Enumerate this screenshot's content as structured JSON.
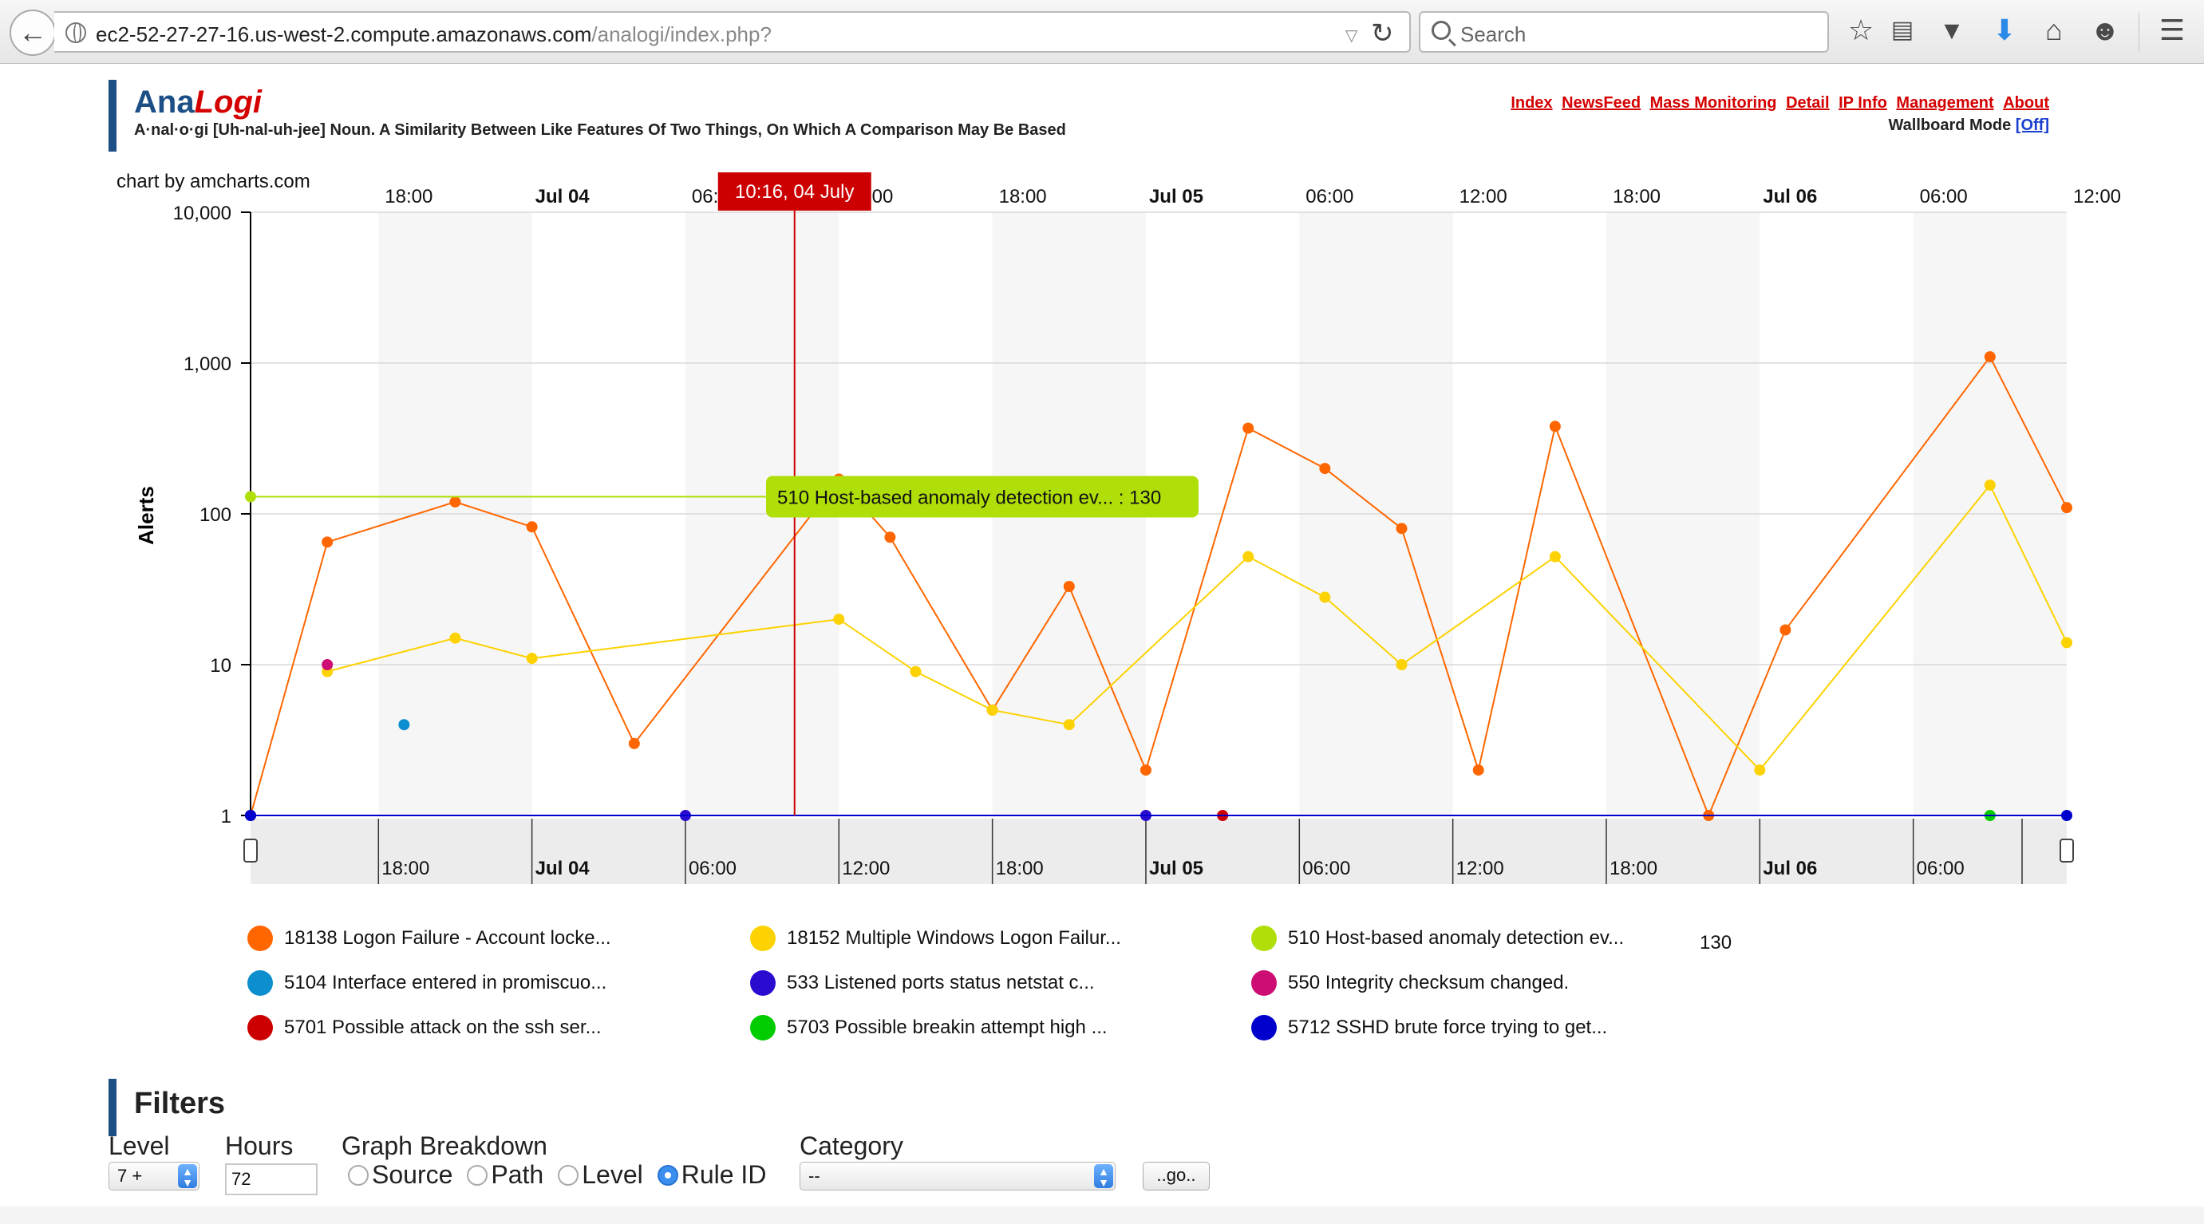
{
  "browser": {
    "url_host": "ec2-52-27-27-16.us-west-2.compute.amazonaws.com",
    "url_path": "/analogi/index.php?",
    "search_placeholder": "Search",
    "icons": [
      "back-arrow-icon",
      "globe-icon",
      "dropdown-arrow-icon",
      "reload-icon",
      "search-icon",
      "bookmark-star-icon",
      "reading-list-icon",
      "pocket-icon",
      "download-icon",
      "home-icon",
      "smiley-icon",
      "hamburger-menu-icon"
    ]
  },
  "header": {
    "brand_ana": "Ana",
    "brand_logi": "Logi",
    "tagline": "A·nal·o·gi [Uh-nal-uh-jee] Noun. A Similarity Between Like Features Of Two Things, On Which A Comparison May Be Based",
    "nav": [
      "Index",
      "NewsFeed",
      "Mass Monitoring",
      "Detail",
      "IP Info",
      "Management",
      "About"
    ],
    "wallboard_label": "Wallboard Mode",
    "wallboard_state": "[Off]"
  },
  "chart_credit": "chart by amcharts.com",
  "chart_data": {
    "type": "line",
    "ylabel": "Alerts",
    "y_scale": "log",
    "ylim": [
      1,
      10000
    ],
    "y_ticks": [
      "1",
      "10",
      "100",
      "1,000",
      "10,000"
    ],
    "x_ticks_top": [
      "18:00",
      "Jul 04",
      "06:00",
      "12:00",
      "18:00",
      "Jul 05",
      "06:00",
      "12:00",
      "18:00",
      "Jul 06",
      "06:00",
      "12:00"
    ],
    "x_ticks_bottom": [
      "18:00",
      "Jul 04",
      "06:00",
      "12:00",
      "18:00",
      "Jul 05",
      "06:00",
      "12:00",
      "18:00",
      "Jul 06",
      "06:00"
    ],
    "cursor_label": "10:16, 04 July",
    "tooltip": "510 Host-based anomaly detection ev... : 130",
    "series": [
      {
        "name": "18138 Logon Failure - Account locke...",
        "color": "#ff6600",
        "points": [
          [
            "2015-07-03 13:00",
            1
          ],
          [
            "2015-07-03 16:00",
            65
          ],
          [
            "2015-07-03 21:00",
            120
          ],
          [
            "2015-07-04 00:00",
            82
          ],
          [
            "2015-07-04 04:00",
            3
          ],
          [
            "2015-07-04 12:00",
            170
          ],
          [
            "2015-07-04 14:00",
            70
          ],
          [
            "2015-07-04 18:00",
            5
          ],
          [
            "2015-07-04 21:00",
            33
          ],
          [
            "2015-07-05 00:00",
            2
          ],
          [
            "2015-07-05 04:00",
            370
          ],
          [
            "2015-07-05 07:00",
            200
          ],
          [
            "2015-07-05 10:00",
            80
          ],
          [
            "2015-07-05 13:00",
            2
          ],
          [
            "2015-07-05 16:00",
            380
          ],
          [
            "2015-07-05 22:00",
            1
          ],
          [
            "2015-07-06 01:00",
            17
          ],
          [
            "2015-07-06 09:00",
            1100
          ],
          [
            "2015-07-06 12:00",
            110
          ]
        ]
      },
      {
        "name": "18152 Multiple Windows Logon Failur...",
        "color": "#fcd202",
        "points": [
          [
            "2015-07-03 16:00",
            9
          ],
          [
            "2015-07-03 21:00",
            15
          ],
          [
            "2015-07-04 00:00",
            11
          ],
          [
            "2015-07-04 12:00",
            20
          ],
          [
            "2015-07-04 15:00",
            9
          ],
          [
            "2015-07-04 18:00",
            5
          ],
          [
            "2015-07-04 21:00",
            4
          ],
          [
            "2015-07-05 04:00",
            52
          ],
          [
            "2015-07-05 07:00",
            28
          ],
          [
            "2015-07-05 10:00",
            10
          ],
          [
            "2015-07-05 16:00",
            52
          ],
          [
            "2015-07-06 00:00",
            2
          ],
          [
            "2015-07-06 09:00",
            155
          ],
          [
            "2015-07-06 12:00",
            14
          ]
        ]
      },
      {
        "name": "510 Host-based anomaly detection ev...",
        "color": "#b0de09",
        "points": [
          [
            "2015-07-03 13:00",
            130
          ],
          [
            "2015-07-04 10:16",
            130
          ]
        ]
      },
      {
        "name": "5104 Interface entered in promiscuo...",
        "color": "#0d8ecf",
        "points": [
          [
            "2015-07-03 19:00",
            4
          ]
        ]
      },
      {
        "name": "533 Listened ports status netstat c...",
        "color": "#2a0cd0",
        "points": [
          [
            "2015-07-03 13:00",
            1
          ],
          [
            "2015-07-04 06:00",
            1
          ],
          [
            "2015-07-05 00:00",
            1
          ]
        ]
      },
      {
        "name": "550 Integrity checksum changed.",
        "color": "#cd0d74",
        "points": [
          [
            "2015-07-03 16:00",
            10
          ]
        ]
      },
      {
        "name": "5701 Possible attack on the ssh ser...",
        "color": "#cc0000",
        "points": [
          [
            "2015-07-05 03:00",
            1
          ]
        ]
      },
      {
        "name": "5703 Possible breakin attempt high ...",
        "color": "#00cc00",
        "points": [
          [
            "2015-07-06 09:00",
            1
          ]
        ]
      },
      {
        "name": "5712 SSHD brute force trying to get...",
        "color": "#0000cc",
        "points": [
          [
            "2015-07-03 13:00",
            1
          ],
          [
            "2015-07-06 12:00",
            1
          ]
        ]
      }
    ],
    "legend_value": "130",
    "legend_placement": "bottom"
  },
  "filters": {
    "title": "Filters",
    "level_label": "Level",
    "level_value": "7 +",
    "hours_label": "Hours",
    "hours_value": "72",
    "breakdown_label": "Graph Breakdown",
    "breakdown_options": [
      "Source",
      "Path",
      "Level",
      "Rule ID"
    ],
    "breakdown_selected": "Rule ID",
    "category_label": "Category",
    "category_value": "--",
    "go_label": "..go.."
  }
}
